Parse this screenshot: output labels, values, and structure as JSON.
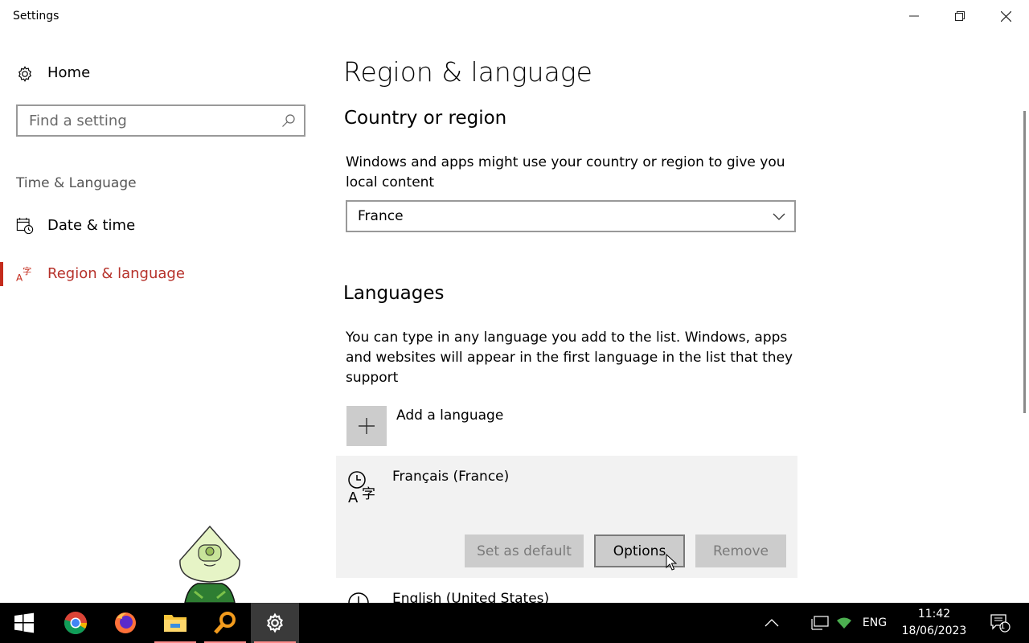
{
  "window": {
    "title": "Settings",
    "minimize_icon": "minimize-icon",
    "maximize_icon": "restore-icon",
    "close_icon": "close-icon"
  },
  "sidebar": {
    "home_label": "Home",
    "search_placeholder": "Find a setting",
    "section_label": "Time & Language",
    "items": [
      {
        "label": "Date & time",
        "icon": "calendar-clock-icon",
        "active": false
      },
      {
        "label": "Region & language",
        "icon": "language-icon",
        "active": true
      }
    ]
  },
  "main": {
    "title": "Region & language",
    "country": {
      "heading": "Country or region",
      "description": "Windows and apps might use your country or region to give you local content",
      "selected": "France"
    },
    "languages": {
      "heading": "Languages",
      "description": "You can type in any language you add to the list. Windows, apps and websites will appear in the first language in the list that they support",
      "add_label": "Add a language",
      "list": [
        {
          "name": "Français (France)",
          "buttons": {
            "set_default": "Set as default",
            "options": "Options",
            "remove": "Remove"
          }
        },
        {
          "name": "English (United States)"
        }
      ]
    }
  },
  "taskbar": {
    "apps": [
      "start-icon",
      "chrome-icon",
      "firefox-icon",
      "file-explorer-icon",
      "search-app-icon",
      "settings-icon"
    ],
    "tray": {
      "language": "ENG",
      "time": "11:42",
      "date": "18/06/2023",
      "notification_count": "1"
    }
  },
  "colors": {
    "accent": "#c42b1c",
    "card_bg": "#f2f2f2",
    "button_bg": "#cccccc"
  }
}
